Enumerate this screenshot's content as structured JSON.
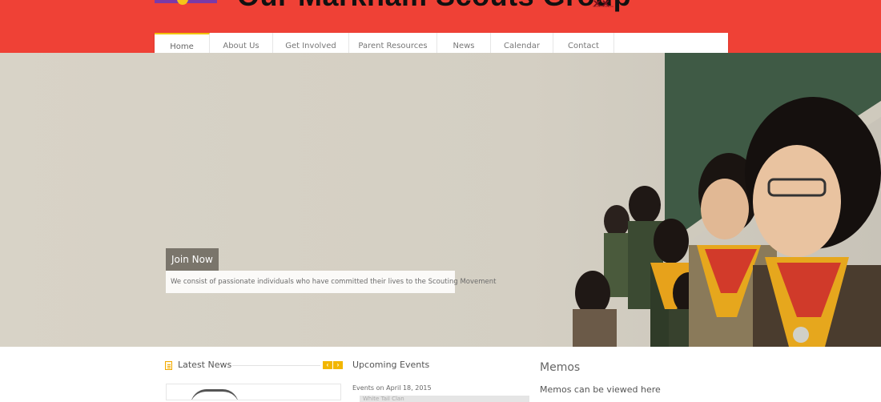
{
  "header": {
    "site_title": "Our Markham Scouts Group",
    "partner_logo_mark": "✕✕",
    "partner_logo_text": "SCOUTS CANADA",
    "background_color": "#ef4136"
  },
  "nav": {
    "items": [
      {
        "label": "Home",
        "active": true
      },
      {
        "label": "About Us"
      },
      {
        "label": "Get Involved"
      },
      {
        "label": "Parent Resources"
      },
      {
        "label": "News"
      },
      {
        "label": "Calendar"
      },
      {
        "label": "Contact"
      }
    ]
  },
  "hero": {
    "tag": "Join Now",
    "description": "We consist of passionate individuals who have committed their lives to the Scouting Movement"
  },
  "latest_news": {
    "title": "Latest News",
    "icon": "news-icon",
    "prev_arrow": "‹",
    "next_arrow": "›",
    "accent_color": "#f2b600"
  },
  "upcoming_events": {
    "title": "Upcoming Events",
    "date_heading": "Events on April 18, 2015",
    "first_event": "White Tail Clan"
  },
  "memos": {
    "title": "Memos",
    "text": "Memos can be viewed here"
  }
}
